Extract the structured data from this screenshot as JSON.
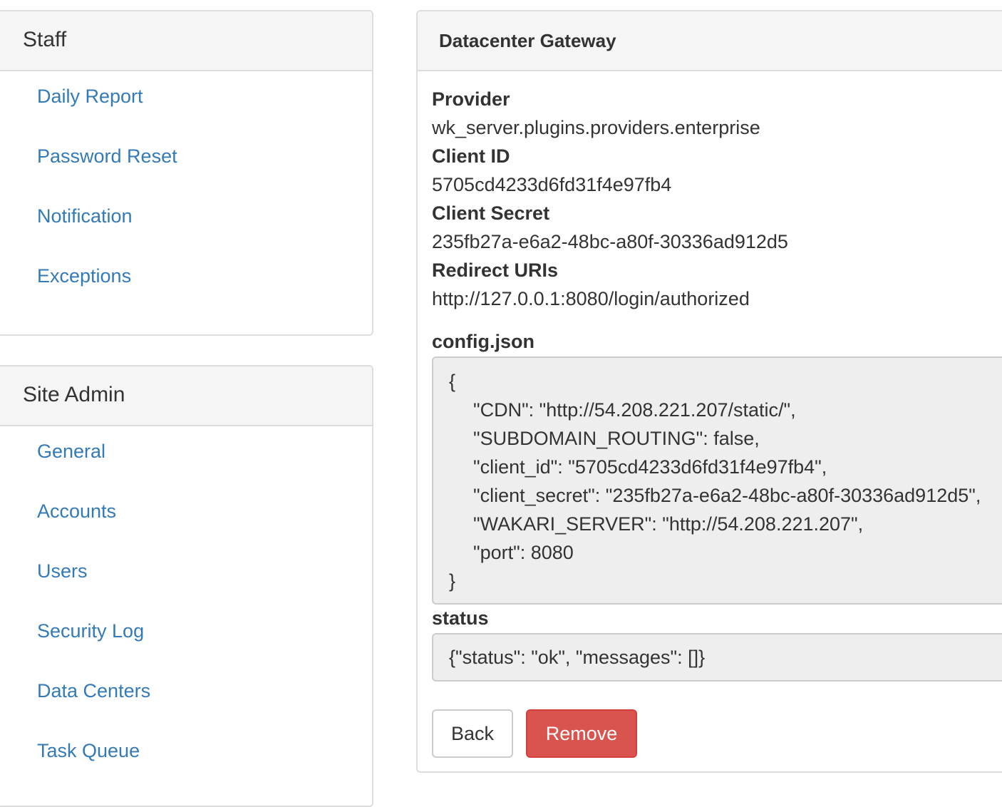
{
  "staff": {
    "title": "Staff",
    "items": [
      {
        "label": "Daily Report"
      },
      {
        "label": "Password Reset"
      },
      {
        "label": "Notification"
      },
      {
        "label": "Exceptions"
      }
    ]
  },
  "site_admin": {
    "title": "Site Admin",
    "items": [
      {
        "label": "General"
      },
      {
        "label": "Accounts"
      },
      {
        "label": "Users"
      },
      {
        "label": "Security Log"
      },
      {
        "label": "Data Centers"
      },
      {
        "label": "Task Queue"
      }
    ]
  },
  "gateway": {
    "title": "Datacenter Gateway",
    "provider_label": "Provider",
    "provider_value": "wk_server.plugins.providers.enterprise",
    "client_id_label": "Client ID",
    "client_id_value": "5705cd4233d6fd31f4e97fb4",
    "client_secret_label": "Client Secret",
    "client_secret_value": "235fb27a-e6a2-48bc-a80f-30336ad912d5",
    "redirect_uris_label": "Redirect URIs",
    "redirect_uris_value": "http://127.0.0.1:8080/login/authorized",
    "config_label": "config.json",
    "config_lines": [
      "{",
      "\"CDN\": \"http://54.208.221.207/static/\",",
      "\"SUBDOMAIN_ROUTING\": false,",
      "\"client_id\": \"5705cd4233d6fd31f4e97fb4\",",
      "\"client_secret\": \"235fb27a-e6a2-48bc-a80f-30336ad912d5\",",
      "\"WAKARI_SERVER\": \"http://54.208.221.207\",",
      "\"port\": 8080",
      "}"
    ],
    "status_label": "status",
    "status_value": "{\"status\": \"ok\", \"messages\": []}",
    "back_label": "Back",
    "remove_label": "Remove"
  },
  "colors": {
    "link": "#337ab7",
    "danger": "#d9534f",
    "heading_bg": "#f5f5f5",
    "code_bg": "#eeeeee",
    "border": "#dddddd"
  }
}
